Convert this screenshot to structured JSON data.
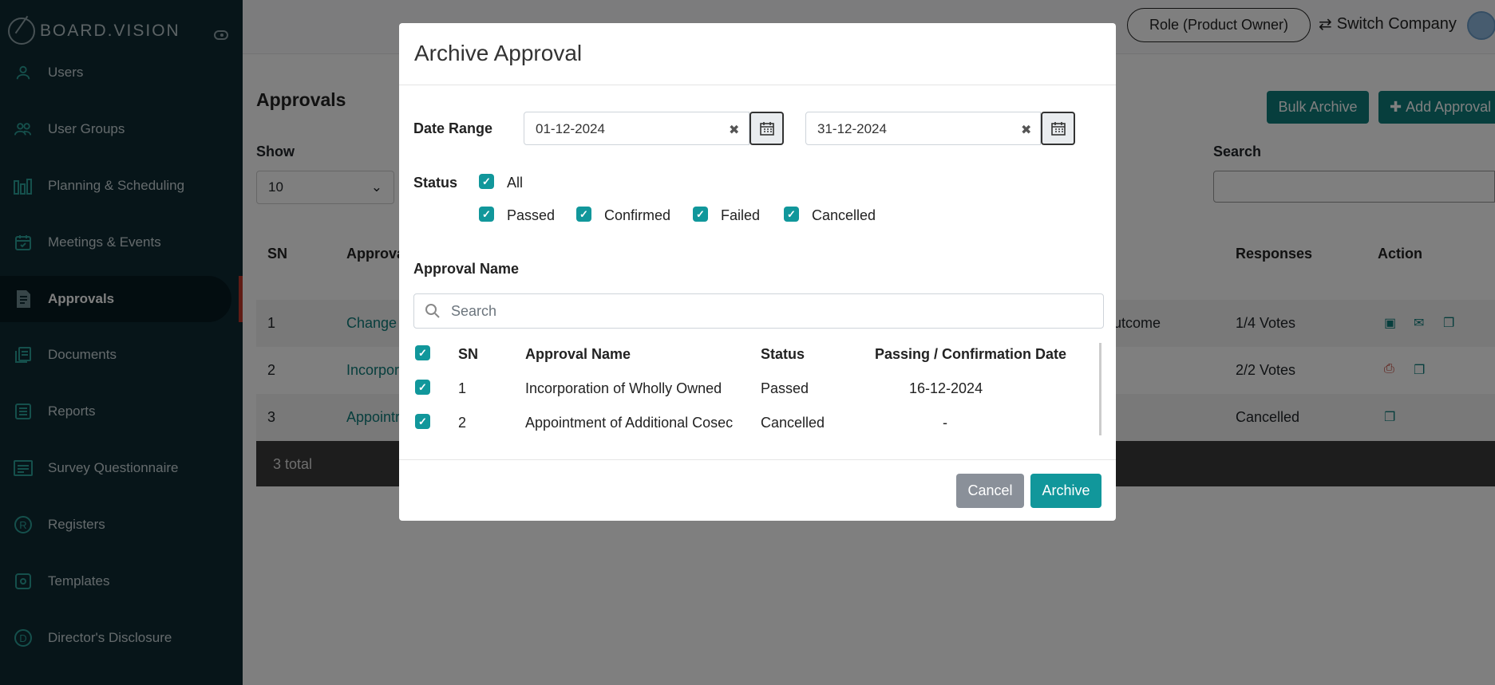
{
  "brand": {
    "name": "BOARD.VISION"
  },
  "sidebar": {
    "items": [
      {
        "label": "Users",
        "icon": "user-icon"
      },
      {
        "label": "User Groups",
        "icon": "users-icon"
      },
      {
        "label": "Planning & Scheduling",
        "icon": "bars-icon"
      },
      {
        "label": "Meetings & Events",
        "icon": "calendar-icon"
      },
      {
        "label": "Approvals",
        "icon": "document-icon",
        "active": true
      },
      {
        "label": "Documents",
        "icon": "documents-icon"
      },
      {
        "label": "Reports",
        "icon": "list-icon"
      },
      {
        "label": "Survey Questionnaire",
        "icon": "survey-icon"
      },
      {
        "label": "Registers",
        "icon": "registered-icon"
      },
      {
        "label": "Templates",
        "icon": "gear-icon"
      },
      {
        "label": "Director's Disclosure",
        "icon": "d-circle-icon"
      }
    ]
  },
  "topbar": {
    "role": "Role (Product Owner)",
    "switch_company": "Switch Company"
  },
  "page": {
    "title": "Approvals",
    "bulk_archive": "Bulk Archive",
    "add_approval": "Add Approval",
    "show_label": "Show",
    "show_value": "10",
    "search_label": "Search"
  },
  "table": {
    "headers": {
      "sn": "SN",
      "approval": "Approva",
      "responses": "Responses",
      "action": "Action"
    },
    "rows": [
      {
        "sn": "1",
        "approval": "Change",
        "outcome": "utcome",
        "responses": "1/4 Votes"
      },
      {
        "sn": "2",
        "approval": "Incorpor",
        "outcome": "",
        "responses": "2/2 Votes"
      },
      {
        "sn": "3",
        "approval": "Appointr",
        "outcome": "",
        "responses": "Cancelled"
      }
    ],
    "footer": "3 total"
  },
  "modal": {
    "title": "Archive Approval",
    "date_range_label": "Date Range",
    "date_from": "01-12-2024",
    "date_to": "31-12-2024",
    "status_label": "Status",
    "status_all": "All",
    "status_options": [
      "Passed",
      "Confirmed",
      "Failed",
      "Cancelled"
    ],
    "approval_name_label": "Approval Name",
    "search_placeholder": "Search",
    "headers": {
      "sn": "SN",
      "name": "Approval Name",
      "status": "Status",
      "date": "Passing / Confirmation Date"
    },
    "rows": [
      {
        "sn": "1",
        "name": "Incorporation of Wholly Owned",
        "status": "Passed",
        "date": "16-12-2024"
      },
      {
        "sn": "2",
        "name": "Appointment of Additional Cosec",
        "status": "Cancelled",
        "date": "-"
      }
    ],
    "cancel": "Cancel",
    "archive": "Archive"
  },
  "colors": {
    "sidebar": "#0f2a33",
    "accent": "#11979b",
    "button_teal": "#0e7c7b",
    "active_marker": "#c0392b"
  }
}
